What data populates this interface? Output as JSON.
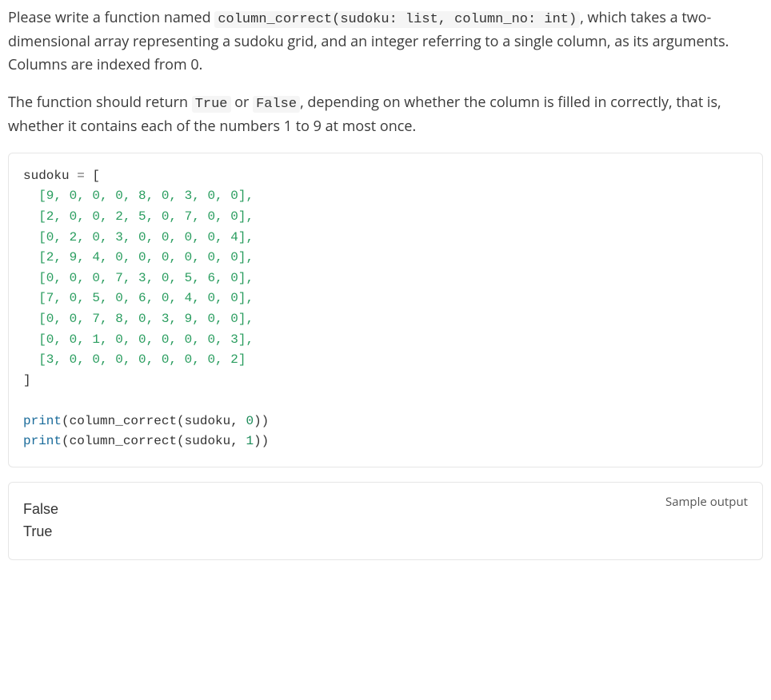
{
  "intro": {
    "p1_pre": "Please write a function named ",
    "p1_code": "column_correct(sudoku: list, column_no: int)",
    "p1_post": ", which takes a two-dimensional array representing a sudoku grid, and an integer referring to a single column, as its arguments. Columns are indexed from 0.",
    "p2_pre": "The function should return ",
    "p2_true": "True",
    "p2_mid": " or ",
    "p2_false": "False",
    "p2_post": ", depending on whether the column is filled in correctly, that is, whether it contains each of the numbers 1 to 9 at most once."
  },
  "code": {
    "assign_left": "sudoku ",
    "assign_eq": "=",
    "assign_right": " [",
    "rows": [
      "[9, 0, 0, 0, 8, 0, 3, 0, 0],",
      "[2, 0, 0, 2, 5, 0, 7, 0, 0],",
      "[0, 2, 0, 3, 0, 0, 0, 0, 4],",
      "[2, 9, 4, 0, 0, 0, 0, 0, 0],",
      "[0, 0, 0, 7, 3, 0, 5, 6, 0],",
      "[7, 0, 5, 0, 6, 0, 4, 0, 0],",
      "[0, 0, 7, 8, 0, 3, 9, 0, 0],",
      "[0, 0, 1, 0, 0, 0, 0, 0, 3],",
      "[3, 0, 0, 0, 0, 0, 0, 0, 2]"
    ],
    "close": "]",
    "call1_print": "print",
    "call1_open": "(column_correct(sudoku, ",
    "call1_arg": "0",
    "call1_close": "))",
    "call2_print": "print",
    "call2_open": "(column_correct(sudoku, ",
    "call2_arg": "1",
    "call2_close": "))"
  },
  "output": {
    "label": "Sample output",
    "line1": "False",
    "line2": "True"
  }
}
